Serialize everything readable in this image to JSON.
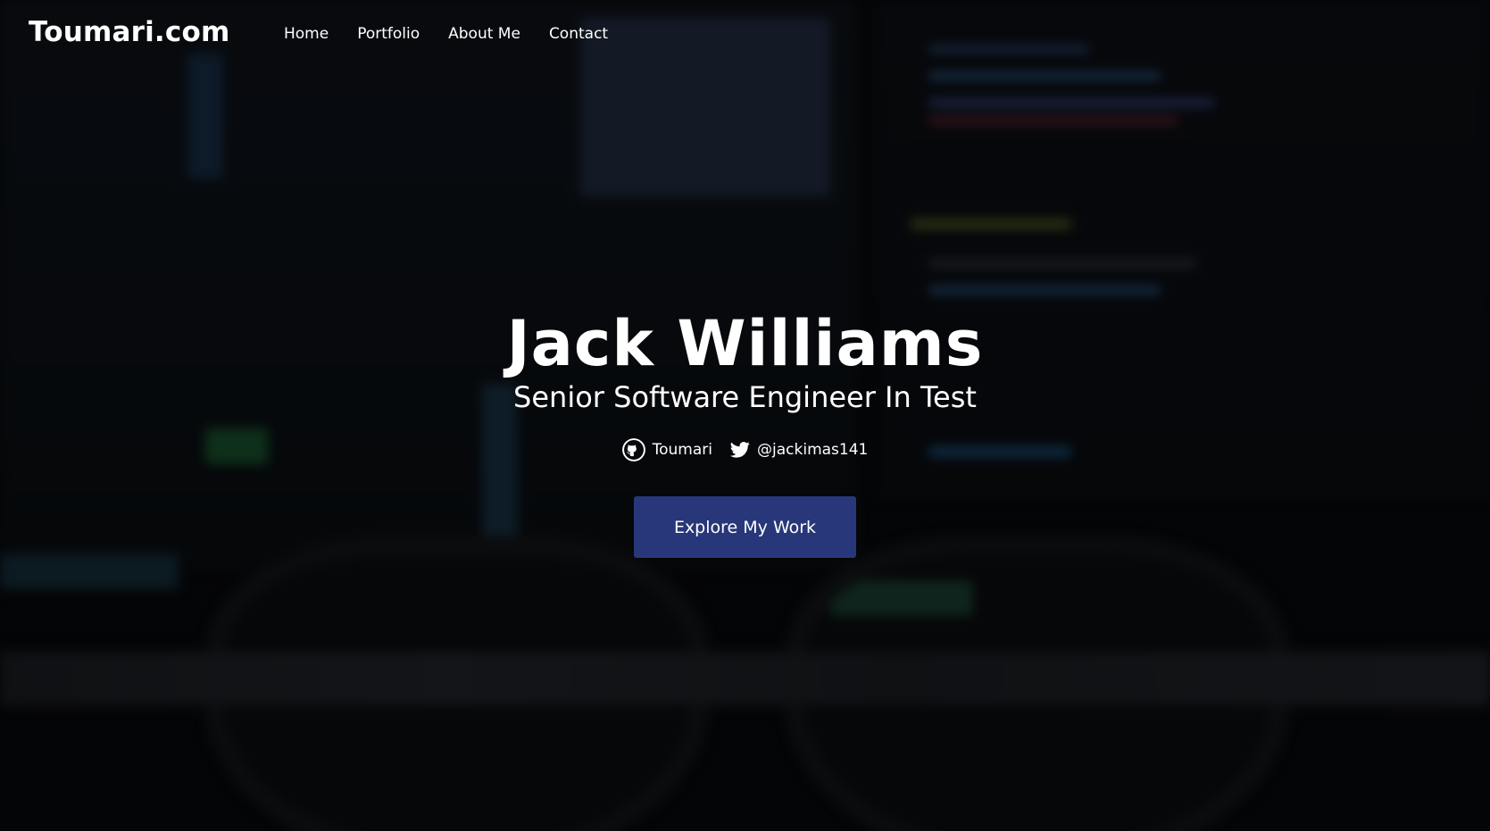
{
  "brand": "Toumari.com",
  "nav": {
    "items": [
      {
        "label": "Home"
      },
      {
        "label": "Portfolio"
      },
      {
        "label": "About Me"
      },
      {
        "label": "Contact"
      }
    ]
  },
  "hero": {
    "name": "Jack Williams",
    "title": "Senior Software Engineer In Test",
    "socials": [
      {
        "icon": "github-icon",
        "label": "Toumari"
      },
      {
        "icon": "twitter-icon",
        "label": "@jackimas141"
      }
    ],
    "cta_label": "Explore My Work"
  },
  "colors": {
    "cta_background": "#283779",
    "text": "#ffffff",
    "overlay": "#000000"
  }
}
